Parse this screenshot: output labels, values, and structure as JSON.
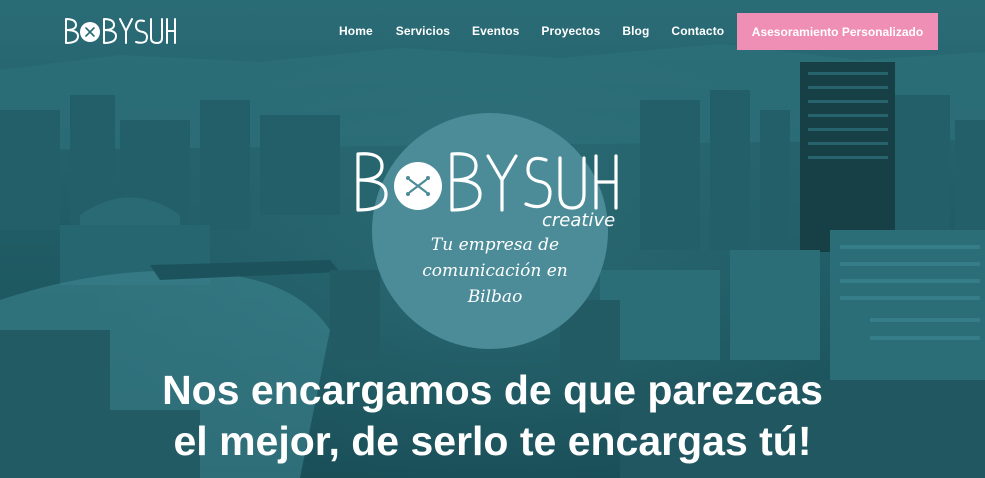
{
  "header": {
    "logo_text": "BOBYSUH",
    "nav": [
      "Home",
      "Servicios",
      "Eventos",
      "Proyectos",
      "Blog",
      "Contacto"
    ],
    "cta_label": "Asesoramiento Personalizado"
  },
  "hero": {
    "brand_name": "BOBYSUH",
    "brand_sub": "creative",
    "tagline": [
      "Tu empresa de",
      "comunicación en",
      "Bilbao"
    ],
    "headline": [
      "Nos encargamos de que parezcas",
      "el mejor, de serlo te encargas tú!"
    ]
  },
  "colors": {
    "cta_bg": "#ef8fb5",
    "circle_bg": "#4c8c98",
    "overlay": "#1f5a64"
  }
}
